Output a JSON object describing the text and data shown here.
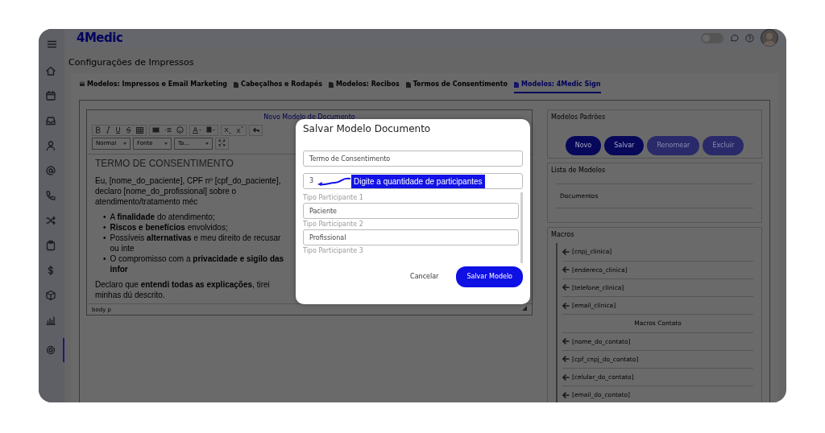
{
  "app": {
    "logo": "4Medic",
    "theme_toggle": {
      "on": false
    }
  },
  "sidebar": {
    "items": [
      {
        "selected": false
      },
      {
        "selected": false
      },
      {
        "selected": false
      },
      {
        "selected": false
      },
      {
        "selected": false
      },
      {
        "selected": false
      },
      {
        "selected": false
      },
      {
        "selected": false
      },
      {
        "selected": false
      },
      {
        "selected": false
      },
      {
        "selected": false
      },
      {
        "selected": true
      }
    ]
  },
  "page_title": "Configurações de Impressos",
  "tabs": [
    {
      "label": "Modelos: Impressos e Email Marketing",
      "selected": false
    },
    {
      "label": "Cabeçalhos e Rodapés",
      "selected": false
    },
    {
      "label": "Modelos: Recibos",
      "selected": false
    },
    {
      "label": "Termos de Consentimento",
      "selected": false
    },
    {
      "label": "Modelos: 4Medic Sign",
      "selected": true
    }
  ],
  "editor": {
    "title": "Novo Modelo de Documento",
    "selects": [
      "Normal",
      "Fonte",
      "Ta..."
    ],
    "heading": "TERMO DE CONSENTIMENTO",
    "intro": "Eu, [nome_do_paciente], CPF nº [cpf_do_paciente], declaro [nome_do_profissional] sobre o atendimento/tratamento méc",
    "bullet_marker": "•",
    "bullets": [
      "A **finalidade** do atendimento;",
      "**Riscos e benefícios** envolvidos;",
      "Possíveis **alternativas** e meu direito de recusar ou inte",
      "O compromisso com a **privacidade e sigilo das infor**"
    ],
    "closing": "Declaro que **entendi todas as explicações**, tirei minhas dú descrito.",
    "status_path": "body  p"
  },
  "right_panel": {
    "default_models": {
      "title": "Modelos Padrões",
      "buttons": [
        {
          "label": "Novo",
          "disabled": false
        },
        {
          "label": "Salvar",
          "disabled": false
        },
        {
          "label": "Renomear",
          "disabled": true
        },
        {
          "label": "Excluir",
          "disabled": true
        }
      ]
    },
    "model_list": {
      "title": "Lista de Modelos",
      "items": [
        "Documentos"
      ]
    },
    "macros": {
      "title": "Macros",
      "items": [
        {
          "kind": "macro",
          "label": "[cnpj_clinica]"
        },
        {
          "kind": "macro",
          "label": "[endereco_clinica]"
        },
        {
          "kind": "macro",
          "label": "[telefone_clinica]"
        },
        {
          "kind": "macro",
          "label": "[email_clinica]"
        },
        {
          "kind": "header",
          "label": "Macros Contato"
        },
        {
          "kind": "macro",
          "label": "[nome_do_contato]"
        },
        {
          "kind": "macro",
          "label": "[cpf_cnpj_do_contato]"
        },
        {
          "kind": "macro",
          "label": "[celular_do_contato]"
        },
        {
          "kind": "macro",
          "label": "[email_do_contato]"
        }
      ]
    }
  },
  "modal": {
    "title": "Salvar Modelo Documento",
    "name_field": {
      "value": "Termo de Consentimento"
    },
    "count_field": {
      "value": "3"
    },
    "annotation": "Digite a quantidade de participantes",
    "participants": [
      {
        "label": "Tipo Participante 1",
        "value": "Paciente"
      },
      {
        "label": "Tipo Participante 2",
        "value": "Profissional"
      }
    ],
    "cut_label": "Tipo Participante 3",
    "buttons": [
      {
        "kind": "secondary",
        "label": "Cancelar"
      },
      {
        "kind": "primary",
        "label": "Salvar Modelo"
      }
    ]
  }
}
